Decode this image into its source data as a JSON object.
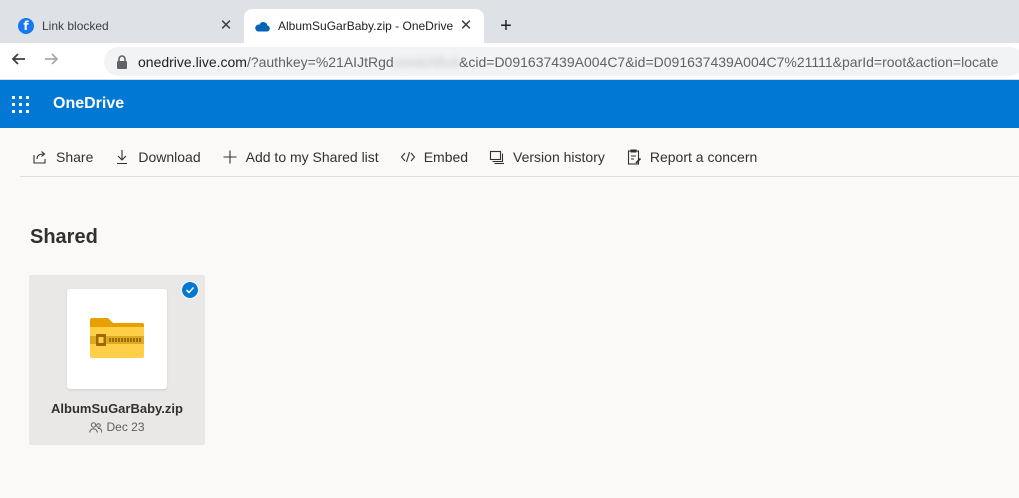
{
  "browser": {
    "tabs": [
      {
        "title": "Link blocked",
        "icon": "facebook-icon",
        "active": false
      },
      {
        "title": "AlbumSuGarBaby.zip - OneDrive",
        "icon": "onedrive-cloud-icon",
        "active": true
      }
    ],
    "new_tab_label": "+",
    "address": {
      "host": "onedrive.live.com",
      "path_start": "/?authkey=%21AIJtRgd",
      "path_obscured": "oewkABuil",
      "path_end": "&cid=D091637439A004C7&id=D091637439A004C7%21111&parId=root&action=locate"
    }
  },
  "app": {
    "brand": "OneDrive",
    "header_color": "#0078d4"
  },
  "commands": [
    {
      "label": "Share",
      "icon": "share-icon"
    },
    {
      "label": "Download",
      "icon": "download-icon"
    },
    {
      "label": "Add to my Shared list",
      "icon": "plus-icon"
    },
    {
      "label": "Embed",
      "icon": "embed-icon"
    },
    {
      "label": "Version history",
      "icon": "version-history-icon"
    },
    {
      "label": "Report a concern",
      "icon": "report-icon"
    }
  ],
  "section": {
    "title": "Shared"
  },
  "files": [
    {
      "name": "AlbumSuGarBaby.zip",
      "date": "Dec 23",
      "icon": "zip-folder-icon",
      "selected": true,
      "shared": true
    }
  ]
}
